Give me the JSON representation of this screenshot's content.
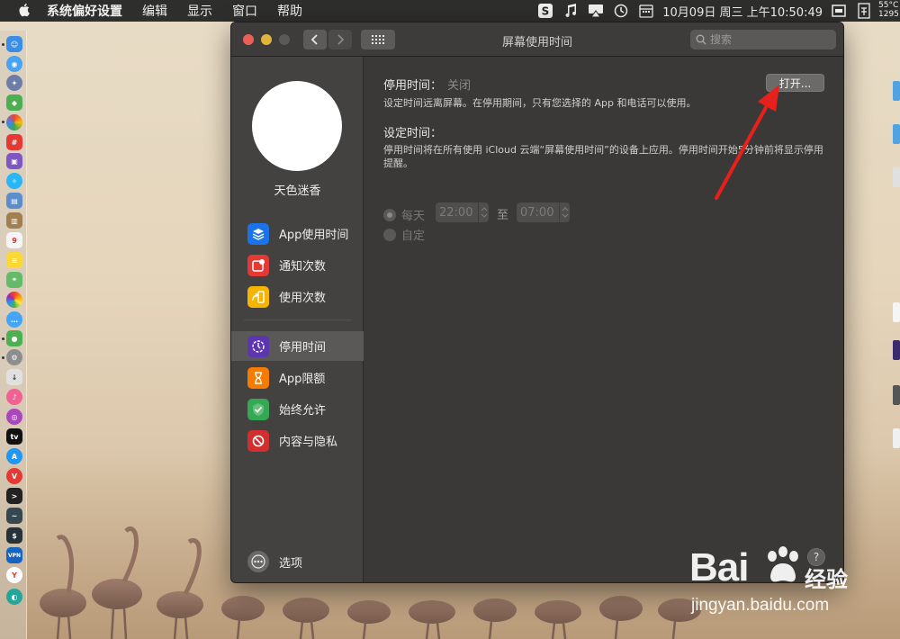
{
  "menubar": {
    "app_name": "系统偏好设置",
    "menus": [
      "编辑",
      "显示",
      "窗口",
      "帮助"
    ],
    "clock": "10月09日 周三 上午10:50:49",
    "stats_line1": "55°C",
    "stats_line2": "1295"
  },
  "window": {
    "title": "屏幕使用时间",
    "search_placeholder": "搜索"
  },
  "sidebar": {
    "username": "天色迷香",
    "items": [
      {
        "label": "App使用时间",
        "color": "#1a73e8"
      },
      {
        "label": "通知次数",
        "color": "#e53935"
      },
      {
        "label": "使用次数",
        "color": "#f4b400"
      },
      {
        "label": "停用时间",
        "color": "#5e35b1"
      },
      {
        "label": "App限额",
        "color": "#f57c00"
      },
      {
        "label": "始终允许",
        "color": "#34a853"
      },
      {
        "label": "内容与隐私",
        "color": "#d32f2f"
      }
    ],
    "options_label": "选项"
  },
  "main": {
    "downtime_label": "停用时间：",
    "downtime_status": "关闭",
    "open_button": "打开...",
    "downtime_desc": "设定时间远离屏幕。在停用期间，只有您选择的 App 和电话可以使用。",
    "schedule_label": "设定时间：",
    "schedule_desc": "停用时间将在所有使用 iCloud 云端“屏幕使用时间”的设备上应用。停用时间开始5分钟前将显示停用提醒。",
    "every_day_label": "每天",
    "start_time": "22:00",
    "to_label": "至",
    "end_time": "07:00",
    "custom_label": "自定",
    "help": "?"
  },
  "watermark": {
    "brand": "Bai",
    "brand_cn": "经验",
    "url": "jingyan.baidu.com"
  }
}
